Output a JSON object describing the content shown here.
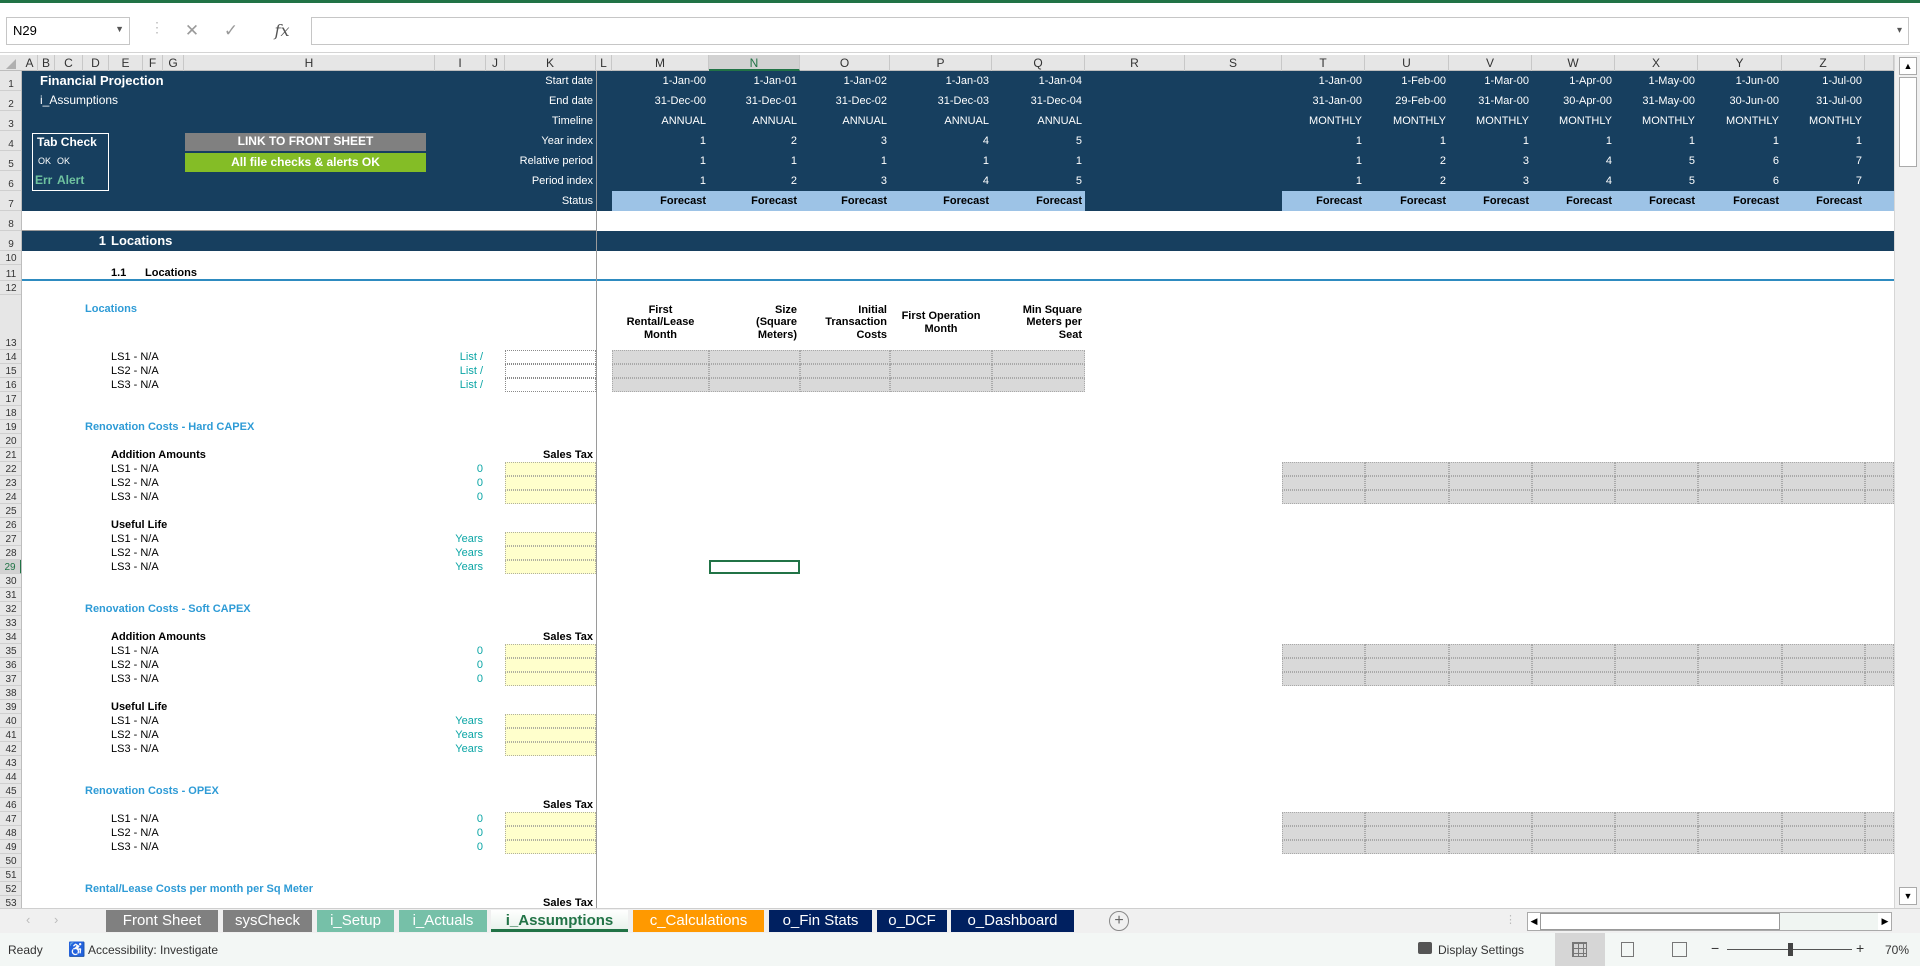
{
  "formula_bar": {
    "name_box": "N29",
    "formula": "",
    "cancel_icon": "cancel-icon",
    "enter_icon": "check-icon",
    "function_icon": "fx"
  },
  "column_headers": [
    "A",
    "B",
    "C",
    "D",
    "E",
    "F",
    "G",
    "H",
    "I",
    "J",
    "K",
    "L",
    "M",
    "N",
    "O",
    "P",
    "Q",
    "R",
    "S",
    "T",
    "U",
    "V",
    "W",
    "X",
    "Y",
    "Z",
    ""
  ],
  "selected_cell": {
    "column": "N",
    "row": "29"
  },
  "row_headers": [
    "1",
    "2",
    "3",
    "4",
    "5",
    "6",
    "7",
    "8",
    "9",
    "10",
    "11",
    "12",
    "13",
    "14",
    "15",
    "16",
    "17",
    "18",
    "19",
    "20",
    "21",
    "22",
    "23",
    "24",
    "25",
    "26",
    "27",
    "28",
    "29",
    "30",
    "31",
    "32",
    "33",
    "34",
    "35",
    "36",
    "37",
    "38",
    "39",
    "40",
    "41",
    "42",
    "43",
    "44",
    "45",
    "46",
    "47",
    "48",
    "49",
    "50",
    "51",
    "52",
    "53"
  ],
  "header": {
    "title": "Financial Projection",
    "sheet_name": "i_Assumptions",
    "tab_check": {
      "title": "Tab Check",
      "ok1": "OK",
      "ok2": "OK",
      "err": "Err",
      "alert": "Alert"
    },
    "link_button": "LINK TO FRONT SHEET",
    "checks_status": "All file checks & alerts OK",
    "timeline_labels": [
      "Start date",
      "End date",
      "Timeline",
      "Year index",
      "Relative period",
      "Period index",
      "Status"
    ]
  },
  "annual_periods": [
    [
      "1-Jan-00",
      "31-Dec-00",
      "ANNUAL",
      "1",
      "1",
      "1",
      "Forecast"
    ],
    [
      "1-Jan-01",
      "31-Dec-01",
      "ANNUAL",
      "2",
      "1",
      "2",
      "Forecast"
    ],
    [
      "1-Jan-02",
      "31-Dec-02",
      "ANNUAL",
      "3",
      "1",
      "3",
      "Forecast"
    ],
    [
      "1-Jan-03",
      "31-Dec-03",
      "ANNUAL",
      "4",
      "1",
      "4",
      "Forecast"
    ],
    [
      "1-Jan-04",
      "31-Dec-04",
      "ANNUAL",
      "5",
      "1",
      "5",
      "Forecast"
    ]
  ],
  "monthly_periods": [
    [
      "1-Jan-00",
      "31-Jan-00",
      "MONTHLY",
      "1",
      "1",
      "1",
      "Forecast"
    ],
    [
      "1-Feb-00",
      "29-Feb-00",
      "MONTHLY",
      "1",
      "2",
      "2",
      "Forecast"
    ],
    [
      "1-Mar-00",
      "31-Mar-00",
      "MONTHLY",
      "1",
      "3",
      "3",
      "Forecast"
    ],
    [
      "1-Apr-00",
      "30-Apr-00",
      "MONTHLY",
      "1",
      "4",
      "4",
      "Forecast"
    ],
    [
      "1-May-00",
      "31-May-00",
      "MONTHLY",
      "1",
      "5",
      "5",
      "Forecast"
    ],
    [
      "1-Jun-00",
      "30-Jun-00",
      "MONTHLY",
      "1",
      "6",
      "6",
      "Forecast"
    ],
    [
      "1-Jul-00",
      "31-Jul-00",
      "MONTHLY",
      "1",
      "7",
      "7",
      "Forecast"
    ]
  ],
  "section": {
    "number": "1",
    "title": "Locations"
  },
  "subsection": {
    "number": "1.1",
    "title": "Locations"
  },
  "locations": {
    "heading": "Locations",
    "column_titles": [
      "First\nRental/Lease\nMonth",
      "Size\n(Square\nMeters)",
      "Initial\nTransaction\nCosts",
      "First Operation\nMonth",
      "Min Square\nMeters per\nSeat"
    ],
    "items": [
      {
        "label": "LS1 - N/A",
        "unit": "List /"
      },
      {
        "label": "LS2 - N/A",
        "unit": "List /"
      },
      {
        "label": "LS3 - N/A",
        "unit": "List /"
      }
    ]
  },
  "renovation_hard": {
    "heading": "Renovation Costs - Hard CAPEX",
    "addition_title": "Addition Amounts",
    "sales_tax": "Sales Tax",
    "addition_items": [
      {
        "label": "LS1 - N/A",
        "value": "0"
      },
      {
        "label": "LS2 - N/A",
        "value": "0"
      },
      {
        "label": "LS3 - N/A",
        "value": "0"
      }
    ],
    "useful_life_title": "Useful Life",
    "useful_life_items": [
      {
        "label": "LS1 - N/A",
        "unit": "Years"
      },
      {
        "label": "LS2 - N/A",
        "unit": "Years"
      },
      {
        "label": "LS3 - N/A",
        "unit": "Years"
      }
    ]
  },
  "renovation_soft": {
    "heading": "Renovation Costs - Soft CAPEX",
    "addition_title": "Addition Amounts",
    "sales_tax": "Sales Tax",
    "addition_items": [
      {
        "label": "LS1 - N/A",
        "value": "0"
      },
      {
        "label": "LS2 - N/A",
        "value": "0"
      },
      {
        "label": "LS3 - N/A",
        "value": "0"
      }
    ],
    "useful_life_title": "Useful Life",
    "useful_life_items": [
      {
        "label": "LS1 - N/A",
        "unit": "Years"
      },
      {
        "label": "LS2 - N/A",
        "unit": "Years"
      },
      {
        "label": "LS3 - N/A",
        "unit": "Years"
      }
    ]
  },
  "renovation_opex": {
    "heading": "Renovation Costs - OPEX",
    "sales_tax": "Sales Tax",
    "items": [
      {
        "label": "LS1 - N/A",
        "value": "0"
      },
      {
        "label": "LS2 - N/A",
        "value": "0"
      },
      {
        "label": "LS3 - N/A",
        "value": "0"
      }
    ]
  },
  "rental": {
    "heading": "Rental/Lease Costs per month per Sq Meter",
    "sales_tax": "Sales Tax"
  },
  "sheet_tabs": [
    {
      "label": "Front Sheet",
      "color": "#808080"
    },
    {
      "label": "sysCheck",
      "color": "#808080"
    },
    {
      "label": "i_Setup",
      "color": "#76c0a8"
    },
    {
      "label": "i_Actuals",
      "color": "#76c0a8"
    },
    {
      "label": "i_Assumptions",
      "color": "#76c0a8",
      "active": true
    },
    {
      "label": "c_Calculations",
      "color": "#ff9900"
    },
    {
      "label": "o_Fin Stats",
      "color": "#002060"
    },
    {
      "label": "o_DCF",
      "color": "#002060"
    },
    {
      "label": "o_Dashboard",
      "color": "#002060"
    }
  ],
  "status_bar": {
    "ready": "Ready",
    "accessibility": "Accessibility: Investigate",
    "display_settings": "Display Settings",
    "zoom": "70%",
    "zoom_level_percent": 70
  },
  "colors": {
    "band": "#173f5f",
    "status_fill": "#9dc3e6",
    "input_fill": "#ffffcc",
    "section_heading": "#2e9bd6",
    "ok_button": "#84bd26",
    "link_button": "#808080",
    "excel_green": "#217346"
  }
}
